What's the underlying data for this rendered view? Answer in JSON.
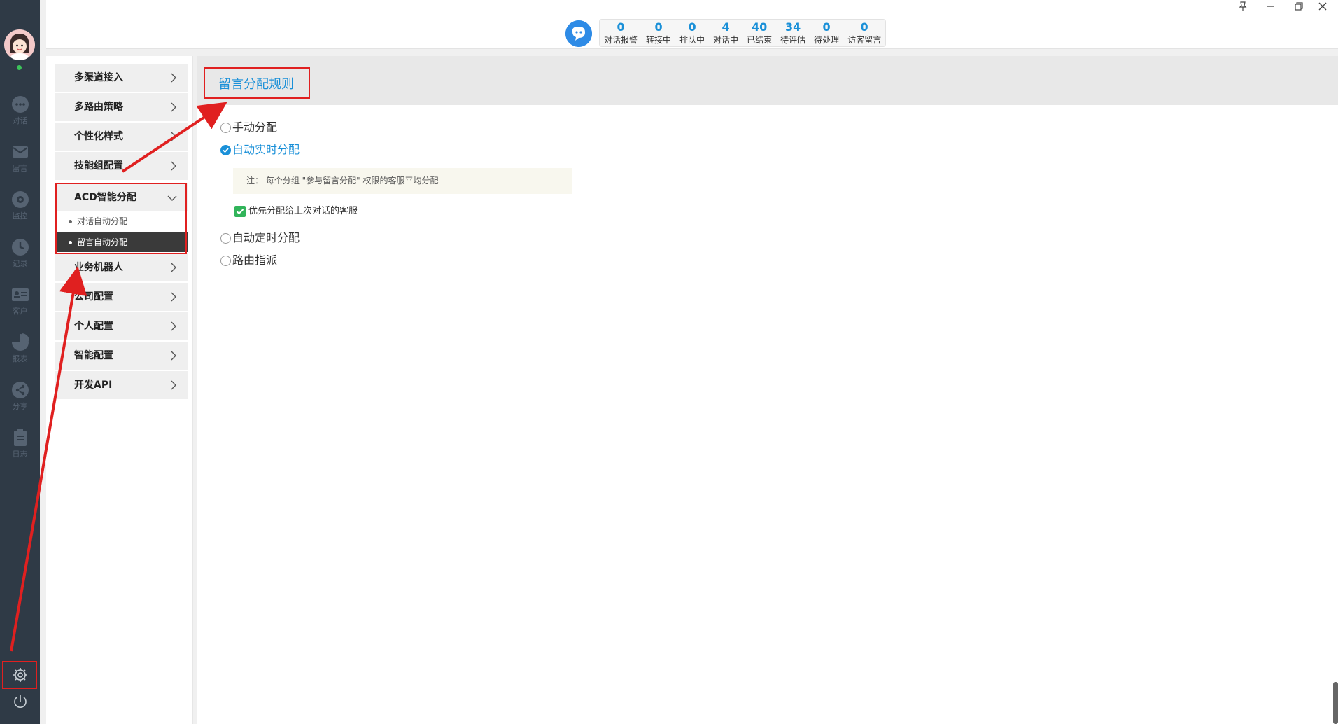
{
  "rail": {
    "items": [
      {
        "icon": "chat-icon",
        "label": "对话"
      },
      {
        "icon": "mail-icon",
        "label": "留言"
      },
      {
        "icon": "eye-icon",
        "label": "监控"
      },
      {
        "icon": "clock-icon",
        "label": "记录"
      },
      {
        "icon": "contact-card-icon",
        "label": "客户"
      },
      {
        "icon": "pie-chart-icon",
        "label": "报表"
      },
      {
        "icon": "share-icon",
        "label": "分享"
      },
      {
        "icon": "clipboard-icon",
        "label": "日志"
      }
    ]
  },
  "stats": [
    {
      "value": "0",
      "label": "对话报警"
    },
    {
      "value": "0",
      "label": "转接中"
    },
    {
      "value": "0",
      "label": "排队中"
    },
    {
      "value": "4",
      "label": "对话中"
    },
    {
      "value": "40",
      "label": "已结束"
    },
    {
      "value": "34",
      "label": "待评估"
    },
    {
      "value": "0",
      "label": "待处理"
    },
    {
      "value": "0",
      "label": "访客留言"
    }
  ],
  "menu": {
    "items": [
      "多渠道接入",
      "多路由策略",
      "个性化样式",
      "技能组配置",
      "ACD智能分配",
      "业务机器人",
      "公司配置",
      "个人配置",
      "智能配置",
      "开发API"
    ],
    "acd_sub": [
      "对话自动分配",
      "留言自动分配"
    ]
  },
  "content": {
    "title": "留言分配规则",
    "opt_manual": "手动分配",
    "opt_auto_realtime": "自动实时分配",
    "note": "注： 每个分组 \"参与留言分配\" 权限的客服平均分配",
    "checkbox_label": "优先分配给上次对话的客服",
    "opt_auto_scheduled": "自动定时分配",
    "opt_route": "路由指派"
  },
  "colors": {
    "accent": "#1a90d8",
    "rail": "#2f3a46",
    "highlight": "#e02020"
  }
}
